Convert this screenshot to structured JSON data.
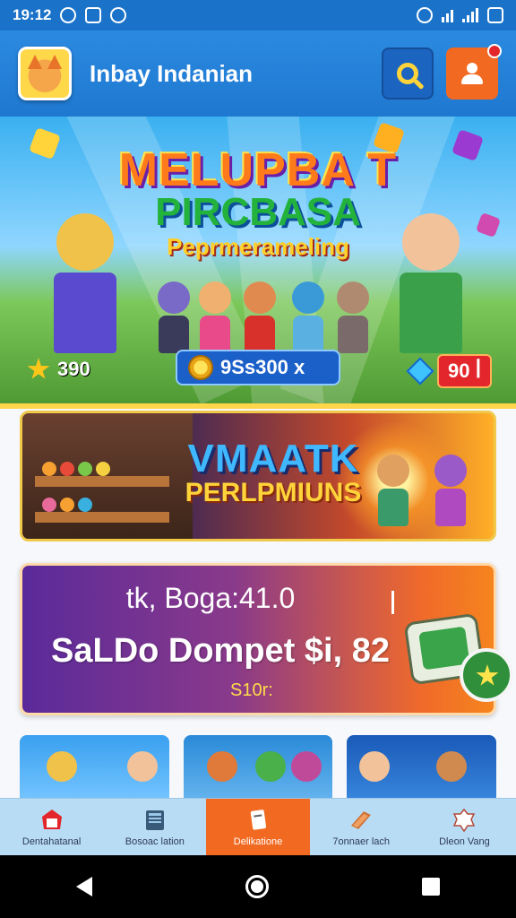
{
  "status_bar": {
    "time": "19:12"
  },
  "header": {
    "title": "Inbay Indanian"
  },
  "hero": {
    "title_line1": "MELUPBA T",
    "title_line2": "PIRCBASA",
    "title_line3": "Peprmerameling",
    "left_value": "390",
    "center_value": "9Ss300 x",
    "right_value": "90 ꟾ"
  },
  "promo": {
    "line1": "VMAATK",
    "line2": "PERLPMIUNS"
  },
  "wallet": {
    "line1": "tk, Boga:41.0",
    "line2": "SaLDo Dompet $i, 82",
    "line3": "S10r:"
  },
  "bottom_nav": {
    "items": [
      {
        "label": "Dentahatanal",
        "icon": "home-icon"
      },
      {
        "label": "Bosoac lation",
        "icon": "book-icon"
      },
      {
        "label": "Delikatione",
        "icon": "document-icon"
      },
      {
        "label": "7onnaer lach",
        "icon": "tools-icon"
      },
      {
        "label": "Dleon Vang",
        "icon": "settings-icon"
      }
    ],
    "active_index": 2
  },
  "colors": {
    "primary": "#1f78d0",
    "accent": "#f26a21",
    "nav_bg": "#b9dcf5"
  }
}
